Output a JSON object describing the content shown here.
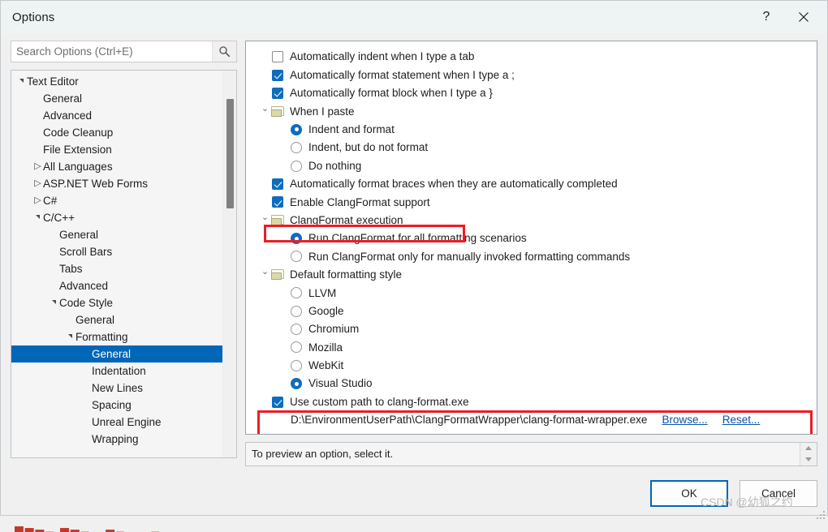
{
  "window": {
    "title": "Options",
    "help_label": "?",
    "close_label": "×"
  },
  "search": {
    "placeholder": "Search Options (Ctrl+E)",
    "value": "",
    "icon": "search-icon"
  },
  "tree": {
    "items": [
      {
        "label": "Text Editor",
        "indent": 0,
        "expander": "down",
        "selected": false
      },
      {
        "label": "General",
        "indent": 1,
        "expander": "none",
        "selected": false
      },
      {
        "label": "Advanced",
        "indent": 1,
        "expander": "none",
        "selected": false
      },
      {
        "label": "Code Cleanup",
        "indent": 1,
        "expander": "none",
        "selected": false
      },
      {
        "label": "File Extension",
        "indent": 1,
        "expander": "none",
        "selected": false
      },
      {
        "label": "All Languages",
        "indent": 1,
        "expander": "right",
        "selected": false
      },
      {
        "label": "ASP.NET Web Forms",
        "indent": 1,
        "expander": "right",
        "selected": false
      },
      {
        "label": "C#",
        "indent": 1,
        "expander": "right",
        "selected": false
      },
      {
        "label": "C/C++",
        "indent": 1,
        "expander": "down",
        "selected": false
      },
      {
        "label": "General",
        "indent": 2,
        "expander": "none",
        "selected": false
      },
      {
        "label": "Scroll Bars",
        "indent": 2,
        "expander": "none",
        "selected": false
      },
      {
        "label": "Tabs",
        "indent": 2,
        "expander": "none",
        "selected": false
      },
      {
        "label": "Advanced",
        "indent": 2,
        "expander": "none",
        "selected": false
      },
      {
        "label": "Code Style",
        "indent": 2,
        "expander": "down",
        "selected": false
      },
      {
        "label": "General",
        "indent": 3,
        "expander": "none",
        "selected": false
      },
      {
        "label": "Formatting",
        "indent": 3,
        "expander": "down",
        "selected": false
      },
      {
        "label": "General",
        "indent": 4,
        "expander": "none",
        "selected": true
      },
      {
        "label": "Indentation",
        "indent": 4,
        "expander": "none",
        "selected": false
      },
      {
        "label": "New Lines",
        "indent": 4,
        "expander": "none",
        "selected": false
      },
      {
        "label": "Spacing",
        "indent": 4,
        "expander": "none",
        "selected": false
      },
      {
        "label": "Unreal Engine",
        "indent": 4,
        "expander": "none",
        "selected": false
      },
      {
        "label": "Wrapping",
        "indent": 4,
        "expander": "none",
        "selected": false
      }
    ]
  },
  "options": {
    "rows": [
      {
        "kind": "checkbox",
        "label": "Automatically indent when I type a tab",
        "checked": false,
        "level": "top"
      },
      {
        "kind": "checkbox",
        "label": "Automatically format statement when I type a ;",
        "checked": true,
        "level": "top"
      },
      {
        "kind": "checkbox",
        "label": "Automatically format block when I type a }",
        "checked": true,
        "level": "top"
      },
      {
        "kind": "group",
        "label": "When I paste",
        "expanded": true
      },
      {
        "kind": "radio",
        "label": "Indent and format",
        "checked": true,
        "level": "child"
      },
      {
        "kind": "radio",
        "label": "Indent, but do not format",
        "checked": false,
        "level": "child"
      },
      {
        "kind": "radio",
        "label": "Do nothing",
        "checked": false,
        "level": "child"
      },
      {
        "kind": "checkbox",
        "label": "Automatically format braces when they are automatically completed",
        "checked": true,
        "level": "top"
      },
      {
        "kind": "checkbox",
        "label": "Enable ClangFormat support",
        "checked": true,
        "level": "top",
        "highlighted": true
      },
      {
        "kind": "group",
        "label": "ClangFormat execution",
        "expanded": true
      },
      {
        "kind": "radio",
        "label": "Run ClangFormat for all formatting scenarios",
        "checked": true,
        "level": "child"
      },
      {
        "kind": "radio",
        "label": "Run ClangFormat only for manually invoked formatting commands",
        "checked": false,
        "level": "child"
      },
      {
        "kind": "group",
        "label": "Default formatting style",
        "expanded": true
      },
      {
        "kind": "radio",
        "label": "LLVM",
        "checked": false,
        "level": "child"
      },
      {
        "kind": "radio",
        "label": "Google",
        "checked": false,
        "level": "child"
      },
      {
        "kind": "radio",
        "label": "Chromium",
        "checked": false,
        "level": "child"
      },
      {
        "kind": "radio",
        "label": "Mozilla",
        "checked": false,
        "level": "child"
      },
      {
        "kind": "radio",
        "label": "WebKit",
        "checked": false,
        "level": "child"
      },
      {
        "kind": "radio",
        "label": "Visual Studio",
        "checked": true,
        "level": "child"
      },
      {
        "kind": "checkbox",
        "label": "Use custom path to clang-format.exe",
        "checked": true,
        "level": "top",
        "highlighted": true
      }
    ],
    "custom_path": {
      "value": "D:\\EnvironmentUserPath\\ClangFormatWrapper\\clang-format-wrapper.exe",
      "browse_label": "Browse...",
      "reset_label": "Reset..."
    },
    "highlight_color": "#ee1c25"
  },
  "preview": {
    "text": "To preview an option, select it.",
    "spinner_up": "spinner-up-icon",
    "spinner_down": "spinner-down-icon"
  },
  "footer": {
    "ok_label": "OK",
    "cancel_label": "Cancel"
  },
  "watermark": {
    "text": "CSDN @幼狐之约"
  },
  "bottom_fragment": {
    "text": "▇▆▅▄  ▆▅▄▃  ▅▄▃▂  ▄▃▂▁"
  },
  "colors": {
    "accent": "#0067b8",
    "control_blue": "#0f6cbd",
    "highlight_red": "#ee1c25",
    "link": "#0a52a8",
    "titlebar_bg": "#eef3f4",
    "dialog_bg": "#f0f0f0"
  }
}
